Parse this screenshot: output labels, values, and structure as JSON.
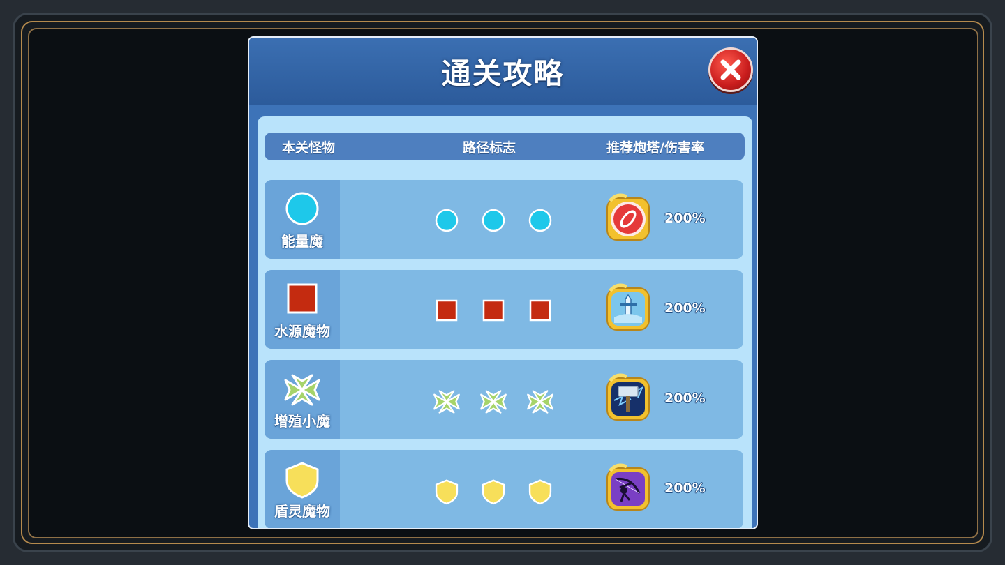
{
  "dialog": {
    "title": "通关攻略",
    "close_label": "关闭"
  },
  "columns": {
    "monsters": "本关怪物",
    "path_marker": "路径标志",
    "tower_damage": "推荐炮塔/伤害率"
  },
  "rows": [
    {
      "name": "能量魔",
      "marker": "cyan-circle",
      "marker_color": "#1ec8ea",
      "tower": "red-feather-tower-icon",
      "damage": "200%"
    },
    {
      "name": "水源魔物",
      "marker": "red-square",
      "marker_color": "#c42b10",
      "tower": "sword-tower-icon",
      "damage": "200%"
    },
    {
      "name": "增殖小魔",
      "marker": "green-clover",
      "marker_color": "#a6d46a",
      "tower": "thunder-hammer-tower-icon",
      "damage": "200%"
    },
    {
      "name": "盾灵魔物",
      "marker": "yellow-shield",
      "marker_color": "#f7df5a",
      "tower": "archer-tower-icon",
      "damage": "200%"
    }
  ]
}
